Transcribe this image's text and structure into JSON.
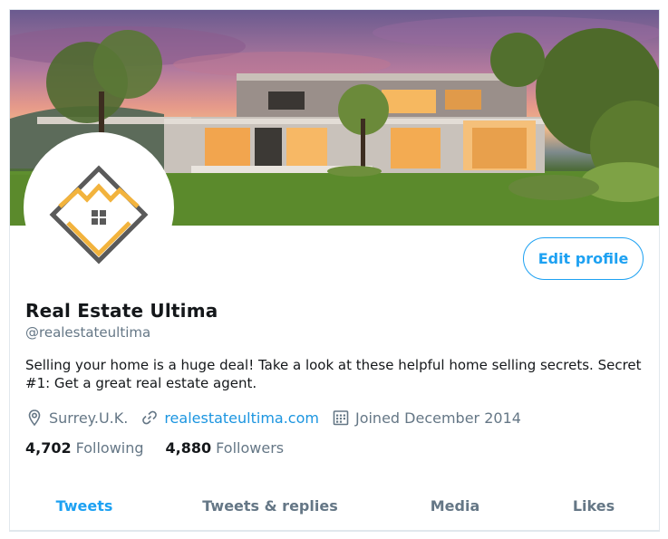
{
  "profile": {
    "display_name": "Real Estate Ultima",
    "handle": "@realestateultima",
    "bio": "Selling your home is a huge deal! Take a look at these helpful home selling secrets. Secret #1: Get a great real estate agent.",
    "location": "Surrey.U.K.",
    "website": "realestateultima.com",
    "joined": "Joined December 2014",
    "edit_label": "Edit profile"
  },
  "stats": {
    "following_count": "4,702",
    "following_label": "Following",
    "followers_count": "4,880",
    "followers_label": "Followers"
  },
  "tabs": [
    {
      "label": "Tweets",
      "active": true
    },
    {
      "label": "Tweets & replies",
      "active": false
    },
    {
      "label": "Media",
      "active": false
    },
    {
      "label": "Likes",
      "active": false
    }
  ],
  "icons": {
    "location": "location-pin-icon",
    "website": "link-icon",
    "joined": "calendar-icon",
    "logo": "house-diamond-logo"
  },
  "colors": {
    "accent": "#1da1f2",
    "link": "#1b95e0",
    "secondary_text": "#657786",
    "logo_gold": "#f2b33d",
    "logo_gray": "#5a5a5a"
  }
}
